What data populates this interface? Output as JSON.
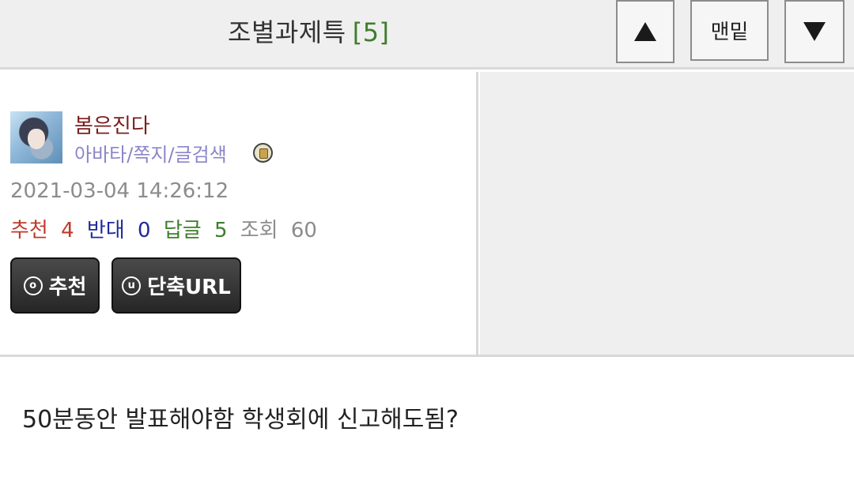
{
  "header": {
    "title": "조별과제특",
    "reply_count": "[5]",
    "up_icon": "triangle-up-icon",
    "bottom_label": "맨밑",
    "down_icon": "triangle-down-icon"
  },
  "author": {
    "avatar_icon": "user-avatar-image",
    "name": "봄은진다",
    "links": "아바타/쪽지/글검색",
    "badge_icon": "member-badge-icon"
  },
  "post": {
    "datetime": "2021-03-04 14:26:12",
    "stats": {
      "recommend_label": "추천",
      "recommend_value": "4",
      "oppose_label": "반대",
      "oppose_value": "0",
      "reply_label": "답글",
      "reply_value": "5",
      "view_label": "조회",
      "view_value": "60"
    },
    "body": "50분동안 발표해야함 학생회에 신고해도됨?"
  },
  "actions": {
    "recommend_icon_text": "o",
    "recommend_label": "추천",
    "shorturl_icon_text": "u",
    "shorturl_label": "단축URL"
  },
  "colors": {
    "header_bg": "#efefef",
    "count_green": "#3e7d2b",
    "username": "#7a1e1e",
    "links": "#8a86c9",
    "recommend_red": "#c0392b",
    "oppose_blue": "#1f2a9a",
    "button_dark": "#2f2f2f"
  }
}
